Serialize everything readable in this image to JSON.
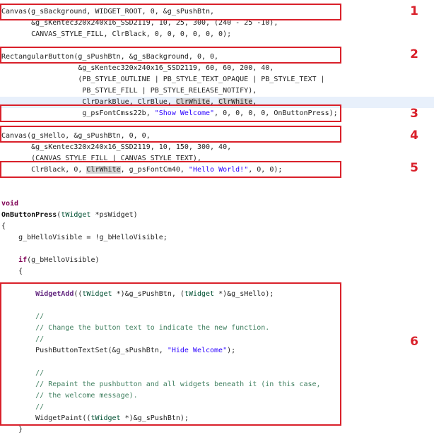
{
  "colors": {
    "annotation": "#d9202a",
    "keyword": "#7f0055",
    "string": "#2a00ff",
    "comment": "#3f7f5f",
    "type": "#005032"
  },
  "annotations": [
    "1",
    "2",
    "3",
    "4",
    "5",
    "6"
  ],
  "lines": [
    [
      [
        "Canvas(g_sBackground, WIDGET_ROOT, 0, &g_sPushBtn,",
        ""
      ]
    ],
    [
      [
        "       &g_sKentec320x240x16_SSD2119, 10, 25, 300, (240 - 25 -10),",
        ""
      ]
    ],
    [
      [
        "       CANVAS_STYLE_FILL, ClrBlack, 0, 0, 0, 0, 0, 0);",
        ""
      ]
    ],
    [],
    [
      [
        "RectangularButton(g_sPushBtn, &g_sBackground, 0, 0,",
        ""
      ]
    ],
    [
      [
        "                  &g_sKentec320x240x16_SSD2119, 60, 60, 200, 40,",
        ""
      ]
    ],
    [
      [
        "                  (PB_STYLE_OUTLINE | PB_STYLE_TEXT_OPAQUE | PB_STYLE_TEXT |",
        ""
      ]
    ],
    [
      [
        "                   PB_STYLE_FILL | PB_STYLE_RELEASE_NOTIFY),",
        ""
      ]
    ],
    [
      [
        "                   ClrDarkBlue, ClrBlue, ",
        ""
      ],
      [
        "ClrWhite",
        "hl"
      ],
      [
        ", ",
        ""
      ],
      [
        "ClrWhite",
        "hl"
      ],
      [
        ",",
        ""
      ]
    ],
    [
      [
        "                   g_psFontCmss22b, ",
        ""
      ],
      [
        "\"Show Welcome\"",
        "str"
      ],
      [
        ", 0, 0, 0, 0, OnButtonPress);",
        ""
      ]
    ],
    [],
    [
      [
        "Canvas(g_sHello, &g_sPushBtn, 0, 0,",
        ""
      ]
    ],
    [
      [
        "       &g_sKentec320x240x16_SSD2119, 10, 150, 300, 40,",
        ""
      ]
    ],
    [
      [
        "       (CANVAS_STYLE_FILL | CANVAS_STYLE_TEXT),",
        ""
      ]
    ],
    [
      [
        "       ClrBlack, 0, ",
        ""
      ],
      [
        "ClrWhite",
        "hl"
      ],
      [
        ", g_psFontCm40, ",
        ""
      ],
      [
        "\"Hello World!\"",
        "str"
      ],
      [
        ", 0, 0);",
        ""
      ]
    ],
    [],
    [],
    [
      [
        "void",
        "kw"
      ]
    ],
    [
      [
        "OnButtonPress",
        "fn"
      ],
      [
        "(",
        ""
      ],
      [
        "tWidget",
        "type"
      ],
      [
        " *psWidget)",
        ""
      ]
    ],
    [
      [
        "{",
        ""
      ]
    ],
    [
      [
        "    g_bHelloVisible = !g_bHelloVisible;",
        ""
      ]
    ],
    [],
    [
      [
        "    ",
        ""
      ],
      [
        "if",
        "kw"
      ],
      [
        "(g_bHelloVisible)",
        ""
      ]
    ],
    [
      [
        "    {",
        ""
      ]
    ],
    [],
    [
      [
        "        ",
        ""
      ],
      [
        "WidgetAdd",
        "fnp"
      ],
      [
        "((",
        ""
      ],
      [
        "tWidget",
        "type"
      ],
      [
        " *)&g_sPushBtn, (",
        ""
      ],
      [
        "tWidget",
        "type"
      ],
      [
        " *)&g_sHello);",
        ""
      ]
    ],
    [],
    [
      [
        "        //",
        "cmt"
      ]
    ],
    [
      [
        "        // Change the button text to indicate the new function.",
        "cmt"
      ]
    ],
    [
      [
        "        //",
        "cmt"
      ]
    ],
    [
      [
        "        PushButtonTextSet(&g_sPushBtn, ",
        ""
      ],
      [
        "\"Hide Welcome\"",
        "str"
      ],
      [
        ");",
        ""
      ]
    ],
    [],
    [
      [
        "        //",
        "cmt"
      ]
    ],
    [
      [
        "        // Repaint the pushbutton and all widgets beneath it (in this case,",
        "cmt"
      ]
    ],
    [
      [
        "        // the welcome message).",
        "cmt"
      ]
    ],
    [
      [
        "        //",
        "cmt"
      ]
    ],
    [
      [
        "        WidgetPaint((",
        ""
      ],
      [
        "tWidget",
        "type"
      ],
      [
        " *)&g_sPushBtn);",
        ""
      ]
    ],
    [
      [
        "    }",
        ""
      ]
    ]
  ]
}
